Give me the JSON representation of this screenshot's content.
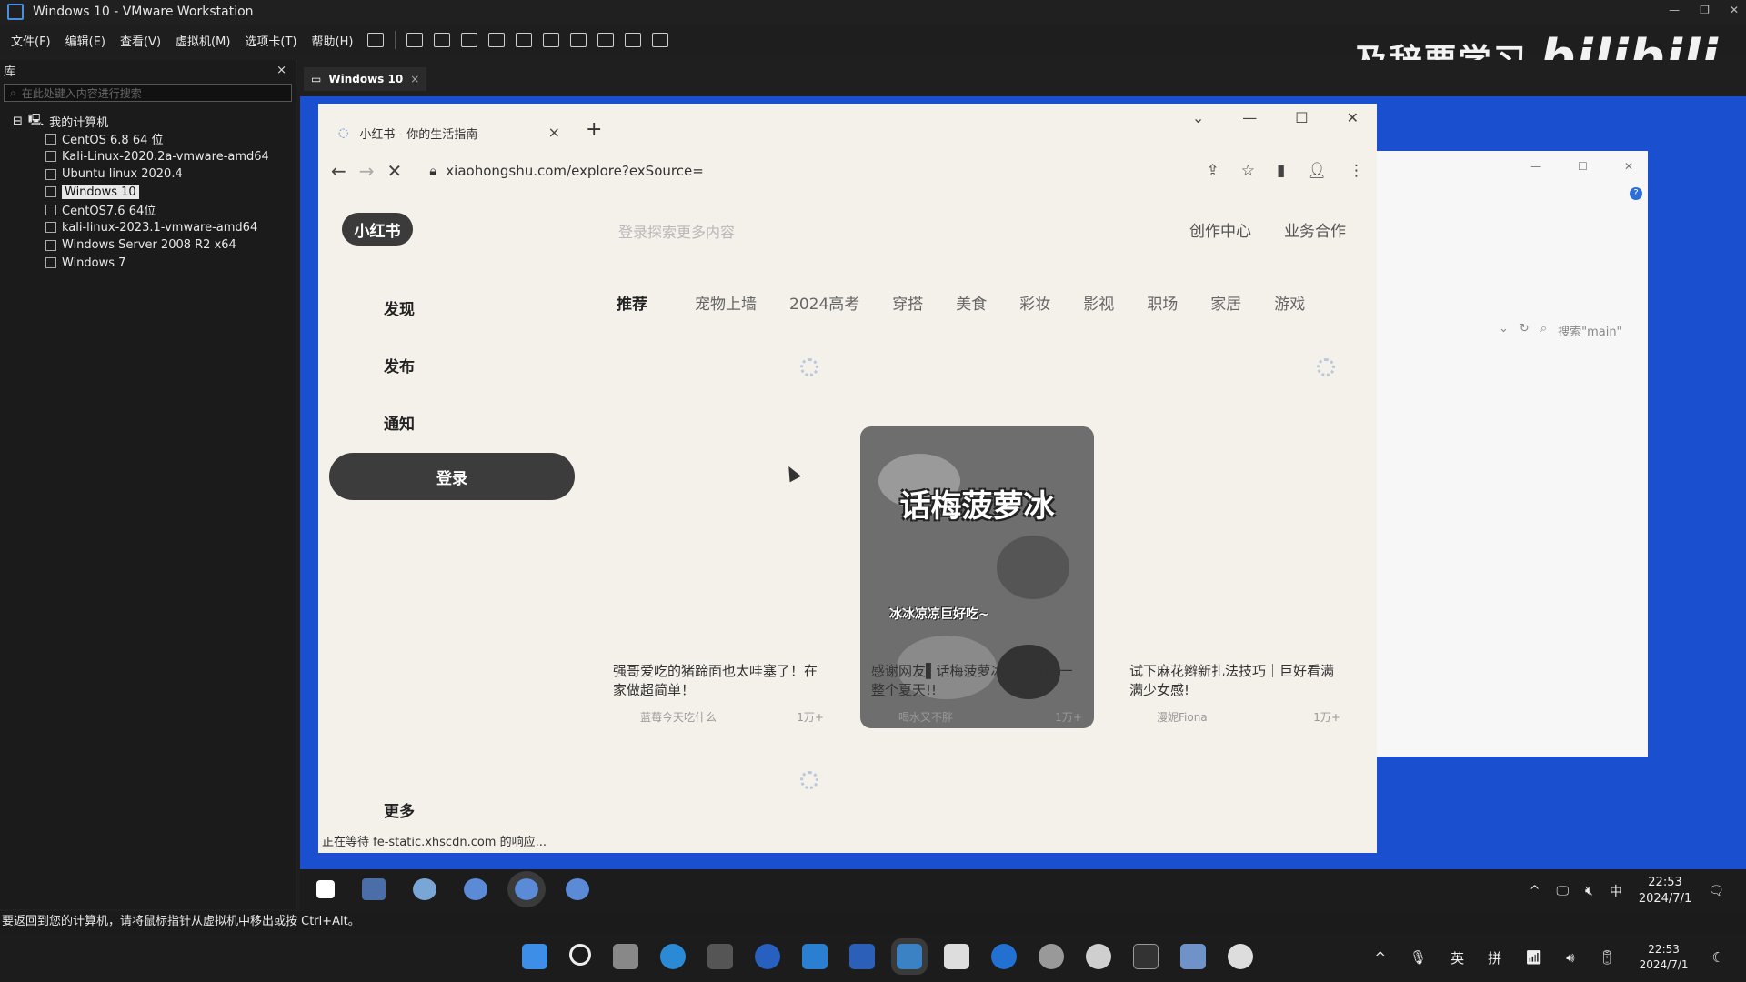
{
  "vmware": {
    "title": "Windows 10 - VMware Workstation",
    "menu": [
      "文件(F)",
      "编辑(E)",
      "查看(V)",
      "虚拟机(M)",
      "选项卡(T)",
      "帮助(H)"
    ],
    "watermark_text": "及辞要学习",
    "watermark_logo": "bilibili",
    "library": {
      "title": "库",
      "close": "×",
      "search_placeholder": "在此处键入内容进行搜索",
      "root": "我的计算机",
      "vms": [
        "CentOS 6.8 64 位",
        "Kali-Linux-2020.2a-vmware-amd64",
        "Ubuntu linux 2020.4",
        "Windows 10",
        "CentOS7.6 64位",
        "kali-linux-2023.1-vmware-amd64",
        "Windows Server 2008 R2 x64",
        "Windows 7"
      ],
      "selected": "Windows 10"
    },
    "vm_tab": "Windows 10",
    "vm_tab_close": "×",
    "status_text": "要返回到您的计算机，请将鼠标指针从虚拟机中移出或按 Ctrl+Alt。"
  },
  "browser": {
    "tab_title": "小红书 - 你的生活指南",
    "tab_close": "×",
    "new_tab": "+",
    "window_controls": [
      "⌄",
      "—",
      "☐",
      "✕"
    ],
    "nav": {
      "back": "←",
      "forward": "→",
      "stop": "✕"
    },
    "url": "xiaohongshu.com/explore?exSource=",
    "status": "正在等待 fe-static.xhscdn.com 的响应..."
  },
  "xhs": {
    "logo": "小红书",
    "search_placeholder": "登录探索更多内容",
    "top_links": [
      "创作中心",
      "业务合作"
    ],
    "sidebar": [
      "发现",
      "发布",
      "通知"
    ],
    "login": "登录",
    "more": "更多",
    "channels_active": "推荐",
    "channels": [
      "宠物上墙",
      "2024高考",
      "穿搭",
      "美食",
      "彩妆",
      "影视",
      "职场",
      "家居",
      "游戏"
    ],
    "cards": [
      {
        "title": "强哥爱吃的猪蹄面也太哇塞了！在家做超简单！",
        "author": "蓝莓今天吃什么",
        "likes": "1万+"
      },
      {
        "title": "感谢网友▌话梅菠萝冰我打算吃一整个夏天!!",
        "author": "喝水又不胖",
        "likes": "1万+",
        "image_title": "话梅菠萝冰",
        "image_caption": "冰冰凉凉巨好吃~"
      },
      {
        "title": "试下麻花辫新扎法技巧｜巨好看满满少女感!",
        "author": "漫妮Fiona",
        "likes": "1万+"
      }
    ]
  },
  "explorer": {
    "search": "搜索\"main\"",
    "help": "?"
  },
  "guest_taskbar": {
    "tray": [
      "^",
      "中"
    ],
    "time": "22:53",
    "date": "2024/7/1"
  },
  "host_taskbar": {
    "tray": [
      "^",
      "英",
      "拼"
    ],
    "time": "22:53",
    "date": "2024/7/1"
  }
}
